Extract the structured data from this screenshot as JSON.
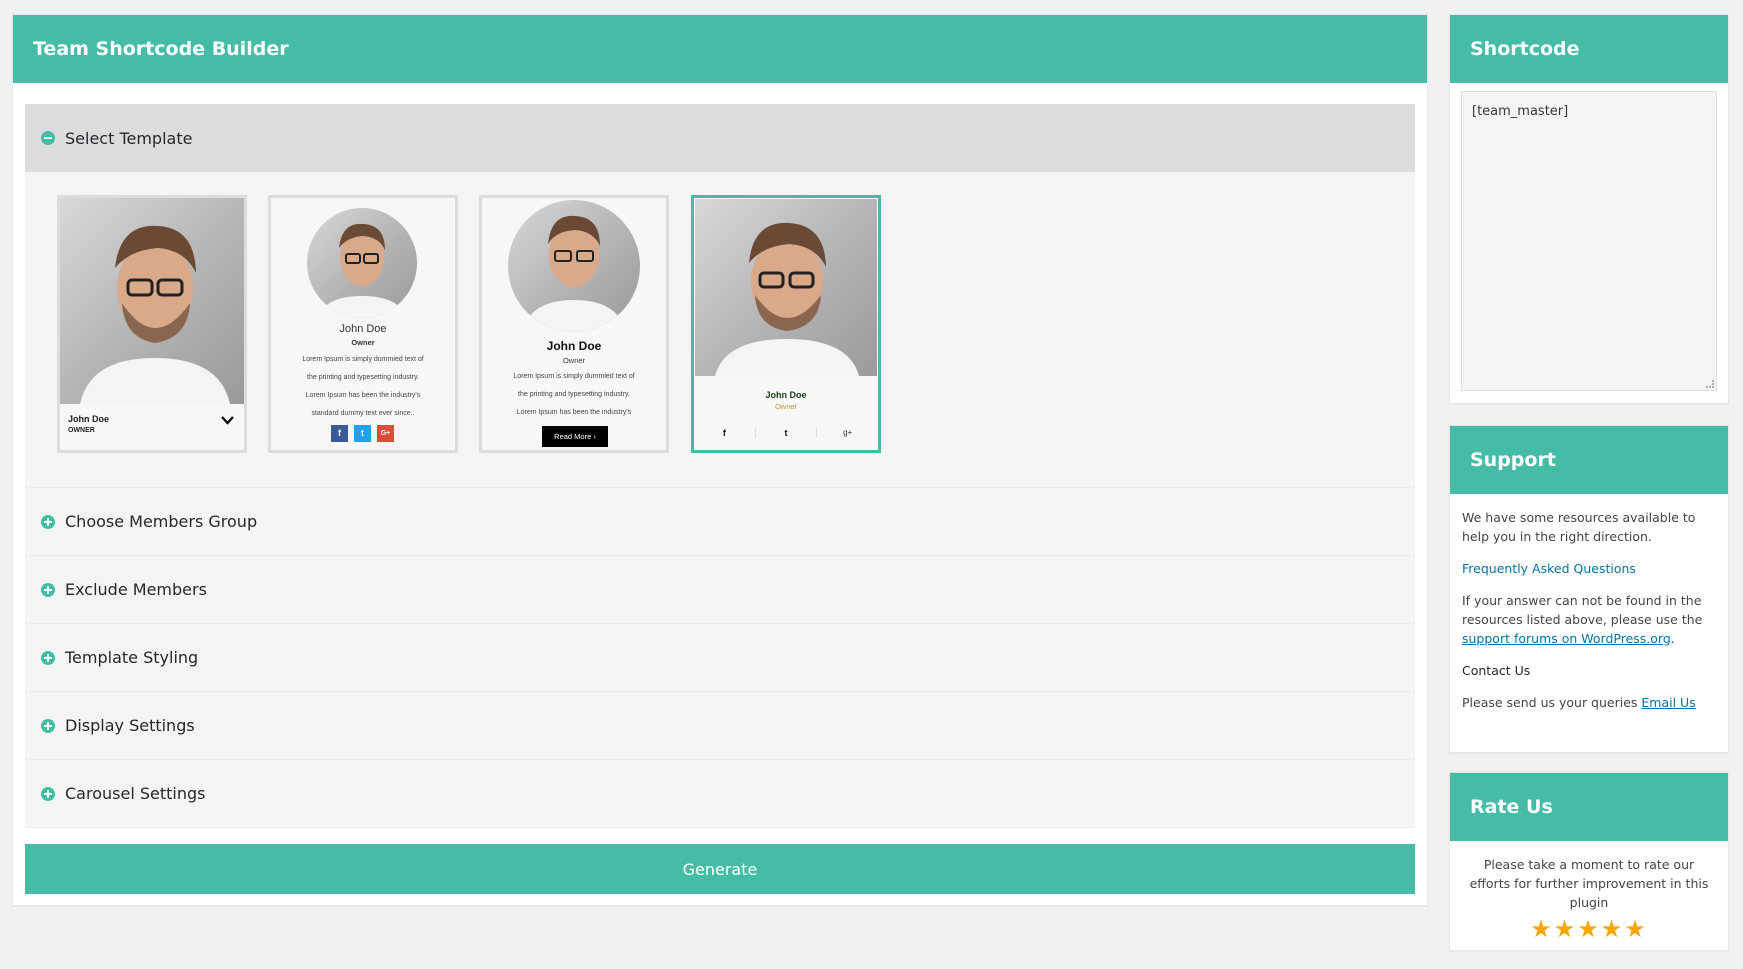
{
  "main": {
    "title": "Team Shortcode Builder",
    "generate_label": "Generate",
    "sections": [
      {
        "label": "Select Template",
        "open": true
      },
      {
        "label": "Choose Members Group",
        "open": false
      },
      {
        "label": "Exclude Members",
        "open": false
      },
      {
        "label": "Template Styling",
        "open": false
      },
      {
        "label": "Display Settings",
        "open": false
      },
      {
        "label": "Carousel Settings",
        "open": false
      }
    ],
    "templates": [
      {
        "name": "John Doe",
        "role": "OWNER"
      },
      {
        "name": "John Doe",
        "role": "Owner",
        "text": [
          "Lorem Ipsum is simply dummied text of",
          "the printing and typesetting industry.",
          "Lorem Ipsum has been the industry's",
          "standard dummy text ever since.."
        ],
        "social": [
          "f",
          "t",
          "G+"
        ]
      },
      {
        "name": "John Doe",
        "role": "Owner",
        "text": [
          "Lorem Ipsum is simply dummied text of",
          "the printing and typesetting industry.",
          "Lorem Ipsum has been the industry's"
        ],
        "button": "Read More ›"
      },
      {
        "name": "John Doe",
        "role": "Owner",
        "social": [
          "f",
          "t",
          "g+"
        ],
        "selected": true
      }
    ]
  },
  "shortcode": {
    "title": "Shortcode",
    "value": "[team_master]"
  },
  "support": {
    "title": "Support",
    "intro": "We have some resources available to help you in the right direction.",
    "faq_link": "Frequently Asked Questions",
    "forum_text": "If your answer can not be found in the resources listed above, please use the",
    "forum_link": "support forums on WordPress.org",
    "forum_end": ".",
    "contact_heading": "Contact Us",
    "contact_text": "Please send us your queries",
    "email_link": "Email Us"
  },
  "rate": {
    "title": "Rate Us",
    "text": "Please take a moment to rate our efforts for further improvement in this plugin",
    "stars": "★★★★★",
    "rating": 5
  },
  "colors": {
    "accent": "#45bca6",
    "link": "#0073aa",
    "star": "#f7a600",
    "facebook": "#3b5998",
    "twitter": "#1da1f2",
    "google": "#dd4b39"
  }
}
